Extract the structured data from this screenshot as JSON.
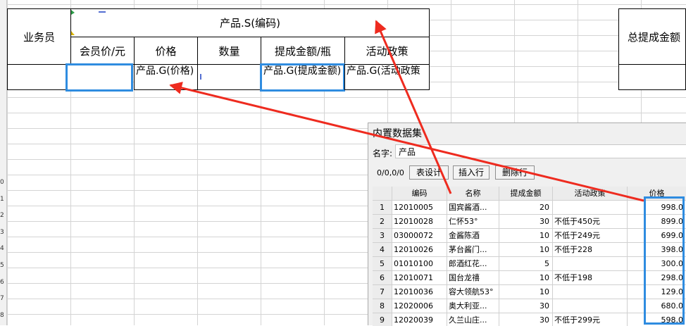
{
  "sheet": {
    "row_numbers": [
      "0",
      "1",
      "2",
      "3",
      "4",
      "5",
      "6",
      "7",
      "8"
    ],
    "header_salesperson": "业务员",
    "header_product_group": "产品.S(编码)",
    "sub_headers": [
      "会员价/元",
      "价格",
      "数量",
      "提成金额/瓶",
      "活动政策"
    ],
    "header_total_commission": "总提成金额",
    "cell_price_formula": "产品.G(价格)",
    "cell_commission_formula": "产品.G(提成金额)",
    "cell_policy_formula": "产品.G(活动政策",
    "cell_corner_mark": "*"
  },
  "dialog": {
    "title": "内置数据集",
    "name_label": "名字:",
    "name_value": "产品",
    "position": "0/0,0/0",
    "buttons": [
      "表设计",
      "插入行",
      "删除行"
    ],
    "columns": [
      "编码",
      "名称",
      "提成金额",
      "活动政策",
      "价格"
    ],
    "rows": [
      {
        "idx": "1",
        "code": "12010005",
        "name": "国宾酱酒...",
        "commission": "20",
        "policy": "",
        "price": "998.0"
      },
      {
        "idx": "2",
        "code": "12010028",
        "name": "仁怀53°",
        "commission": "30",
        "policy": "不低于450元",
        "price": "899.0"
      },
      {
        "idx": "3",
        "code": "03000072",
        "name": "金酱陈酒",
        "commission": "10",
        "policy": "不低于249元",
        "price": "699.0"
      },
      {
        "idx": "4",
        "code": "12010026",
        "name": "茅台酱门...",
        "commission": "10",
        "policy": "不低于228",
        "price": "398.0"
      },
      {
        "idx": "5",
        "code": "01010100",
        "name": "郎酒红花...",
        "commission": "5",
        "policy": "",
        "price": "300.0"
      },
      {
        "idx": "6",
        "code": "12010071",
        "name": "国台龙禧",
        "commission": "10",
        "policy": "不低于198",
        "price": "298.0"
      },
      {
        "idx": "7",
        "code": "12010036",
        "name": "容大领航53°",
        "commission": "10",
        "policy": "",
        "price": "129.0"
      },
      {
        "idx": "8",
        "code": "12020006",
        "name": "奥大利亚...",
        "commission": "30",
        "policy": "",
        "price": "680.0"
      },
      {
        "idx": "9",
        "code": "12020039",
        "name": "久兰山庄...",
        "commission": "30",
        "policy": "不低于299元",
        "price": "598.0"
      }
    ]
  },
  "colors": {
    "highlight": "#2f8ce0",
    "arrow": "#ee2b1f"
  }
}
